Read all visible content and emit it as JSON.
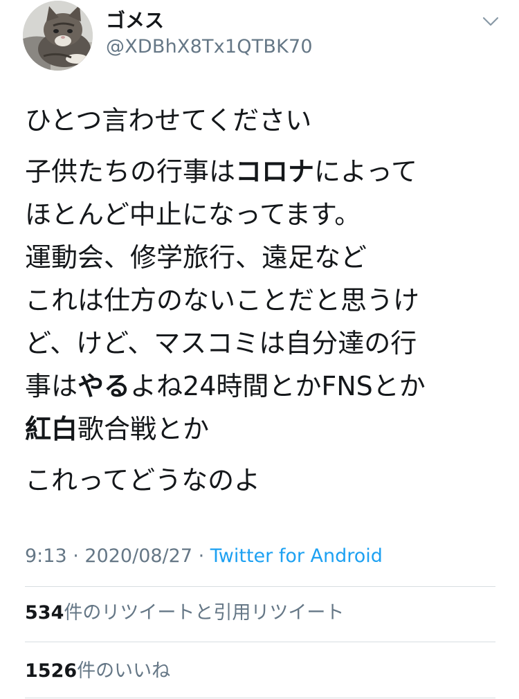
{
  "user": {
    "display_name": "ゴメス",
    "handle": "@XDBhX8Tx1QTBK70",
    "avatar_icon": "cat-photo-avatar"
  },
  "menu_icon": "chevron-down-icon",
  "tweet": {
    "paragraphs": [
      [
        [
          {
            "text": "ひとつ言わせてください",
            "bold": false
          }
        ]
      ],
      [
        [
          {
            "text": "子供たちの行事は",
            "bold": false
          },
          {
            "text": "コロナ",
            "bold": true
          },
          {
            "text": "によって",
            "bold": false
          }
        ],
        [
          {
            "text": "ほとんど中止になってます。",
            "bold": false
          }
        ],
        [
          {
            "text": "運動会、修学旅行、遠足など",
            "bold": false
          }
        ],
        [
          {
            "text": "これは仕方のないことだと思うけ",
            "bold": false
          }
        ],
        [
          {
            "text": "ど、けど、マスコミは自分達の行",
            "bold": false
          }
        ],
        [
          {
            "text": "事は",
            "bold": false
          },
          {
            "text": "やる",
            "bold": true
          },
          {
            "text": "よね24時間とかFNSとか",
            "bold": false
          }
        ],
        [
          {
            "text": "紅白",
            "bold": true
          },
          {
            "text": "歌合戦とか",
            "bold": false
          }
        ]
      ],
      [
        [
          {
            "text": "これってどうなのよ",
            "bold": false
          }
        ]
      ]
    ]
  },
  "meta": {
    "time": "9:13",
    "sep1": " · ",
    "date": "2020/08/27",
    "sep2": " · ",
    "source": "Twitter for Android"
  },
  "stats": {
    "retweets": {
      "count": "534",
      "label": "件のリツイートと引用リツイート"
    },
    "likes": {
      "count": "1526",
      "label": "件のいいね"
    }
  },
  "colors": {
    "text": "#14171a",
    "secondary": "#657786",
    "link": "#1da1f2",
    "divider": "#d8dde1"
  }
}
